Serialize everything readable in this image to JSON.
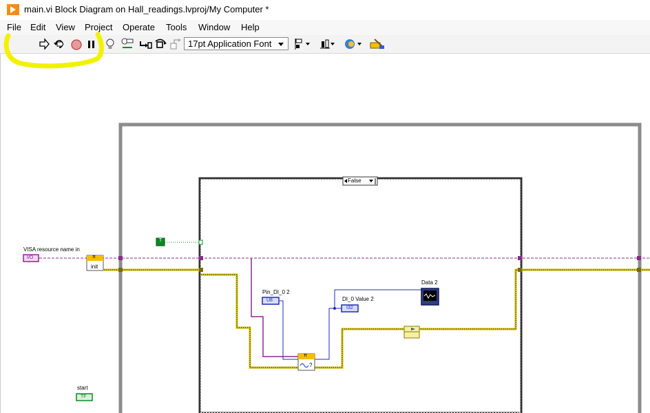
{
  "window": {
    "title": "main.vi Block Diagram on Hall_readings.lvproj/My Computer *"
  },
  "menu": {
    "items": [
      "File",
      "Edit",
      "View",
      "Project",
      "Operate",
      "Tools",
      "Window",
      "Help"
    ]
  },
  "toolbar": {
    "font_select_value": "17pt Application Font",
    "buttons": [
      "run-arrow-icon",
      "run-continuously-icon",
      "abort-execution-icon",
      "pause-icon",
      "highlight-execution-icon",
      "retain-wire-values-icon",
      "step-into-icon",
      "step-over-icon",
      "step-out-icon",
      "align-objects-icon",
      "distribute-objects-icon",
      "reorder-icon",
      "clean-up-diagram-icon"
    ]
  },
  "diagram": {
    "case_selector_value": "False",
    "labels": {
      "visa_resource": "VISA resource name in",
      "pin_di": "Pin_DI_0 2",
      "di_value": "DI_0 Value 2",
      "data2": "Data 2",
      "start": "start"
    },
    "terminals": {
      "visa": "I/O",
      "u8": "U8",
      "i32": "I32",
      "tf": "TF",
      "true_const": "T"
    },
    "node_text": {
      "init": "init",
      "pi_header": "π",
      "read_q": "?"
    }
  },
  "colors": {
    "highlight": "#f2f200",
    "loop_frame": "#8c8c8c",
    "wire_resource": "#8a2a8a",
    "wire_error": "#c9b800",
    "wire_numeric": "#1f2bb5",
    "wire_boolean": "#0a8a22",
    "case_frame": "#333333"
  }
}
